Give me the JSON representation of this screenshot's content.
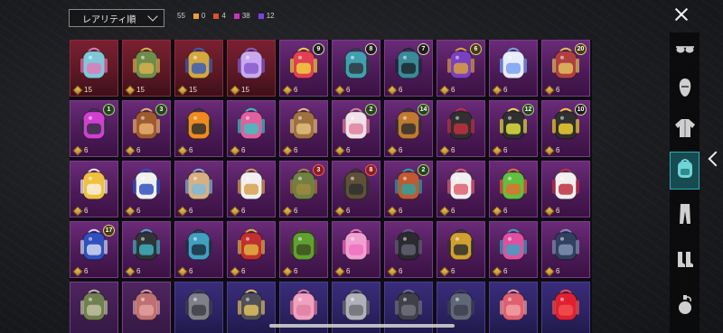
{
  "header": {
    "sort_label": "レアリティ順",
    "total_count": "55",
    "rarity_counts": [
      {
        "color": "#f0a030",
        "count": "0"
      },
      {
        "color": "#e05030",
        "count": "4"
      },
      {
        "color": "#d030c0",
        "count": "38"
      },
      {
        "color": "#8040e0",
        "count": "12"
      }
    ]
  },
  "items": [
    {
      "icon": "backpack-teal-icon",
      "qty": "15",
      "rarity": "red",
      "c1": "#7fc8d8",
      "c2": "#e07ab8"
    },
    {
      "icon": "backpack-green-icon",
      "qty": "15",
      "rarity": "red",
      "c1": "#6f8d4a",
      "c2": "#d8b050"
    },
    {
      "icon": "backpack-gold-blue-icon",
      "qty": "15",
      "rarity": "red",
      "c1": "#d4a840",
      "c2": "#3a5fb8"
    },
    {
      "icon": "backpack-butterfly-icon",
      "qty": "15",
      "rarity": "red",
      "c1": "#c9a8f0",
      "c2": "#8a5ad0"
    },
    {
      "icon": "backpack-clown-icon",
      "qty": "6",
      "badge": "9",
      "badge_style": "",
      "c1": "#e04050",
      "c2": "#f0d040"
    },
    {
      "icon": "backpack-robot-icon",
      "qty": "6",
      "badge": "8",
      "badge_style": "",
      "c1": "#40a0b0",
      "c2": "#303840"
    },
    {
      "icon": "backpack-mech-icon",
      "qty": "6",
      "badge": "7",
      "badge_style": "",
      "c1": "#3a8a98",
      "c2": "#1c2830"
    },
    {
      "icon": "backpack-arch-icon",
      "qty": "6",
      "badge": "6",
      "badge_style": "gold",
      "c1": "#7a40c0",
      "c2": "#d8a040"
    },
    {
      "icon": "backpack-bunny-icon",
      "qty": "6",
      "c1": "#e8ecff",
      "c2": "#7aa0f0"
    },
    {
      "icon": "backpack-bear-red-icon",
      "qty": "6",
      "badge": "20",
      "badge_style": "gold",
      "c1": "#b04040",
      "c2": "#e0c060"
    },
    {
      "icon": "backpack-crystal-icon",
      "qty": "6",
      "badge": "1",
      "badge_style": "green",
      "c1": "#d040d0",
      "c2": "#303040"
    },
    {
      "icon": "backpack-teddy-icon",
      "qty": "6",
      "badge": "3",
      "badge_style": "green",
      "c1": "#a05a30",
      "c2": "#e8b070"
    },
    {
      "icon": "backpack-orange-ball-icon",
      "qty": "6",
      "c1": "#f08a20",
      "c2": "#303030"
    },
    {
      "icon": "backpack-candy-icon",
      "qty": "6",
      "c1": "#e060a0",
      "c2": "#40c0c0"
    },
    {
      "icon": "backpack-chest-icon",
      "qty": "6",
      "c1": "#a07040",
      "c2": "#e0c080"
    },
    {
      "icon": "backpack-shell-icon",
      "qty": "6",
      "badge": "2",
      "badge_style": "green",
      "c1": "#f0e0e8",
      "c2": "#e080a0"
    },
    {
      "icon": "backpack-bronze-icon",
      "qty": "6",
      "badge": "14",
      "badge_style": "green",
      "c1": "#c07a30",
      "c2": "#303030"
    },
    {
      "icon": "backpack-dark-red-icon",
      "qty": "6",
      "c1": "#303030",
      "c2": "#c03040"
    },
    {
      "icon": "backpack-tablet-icon",
      "qty": "6",
      "badge": "12",
      "badge_style": "green",
      "c1": "#303030",
      "c2": "#e0e040"
    },
    {
      "icon": "backpack-phone-icon",
      "qty": "6",
      "badge": "10",
      "badge_style": "",
      "c1": "#303030",
      "c2": "#f0d030"
    },
    {
      "icon": "backpack-tiger-icon",
      "qty": "6",
      "c1": "#f0c040",
      "c2": "#f8f0e0"
    },
    {
      "icon": "backpack-striped-icon",
      "qty": "6",
      "c1": "#f0f0f0",
      "c2": "#3050c0"
    },
    {
      "icon": "backpack-doll-icon",
      "qty": "6",
      "c1": "#d8b080",
      "c2": "#80b8d8"
    },
    {
      "icon": "backpack-chef-icon",
      "qty": "6",
      "c1": "#f0f0f0",
      "c2": "#d8a050"
    },
    {
      "icon": "backpack-camo-icon",
      "qty": "6",
      "badge": "3",
      "badge_style": "red",
      "c1": "#708040",
      "c2": "#a08840"
    },
    {
      "icon": "backpack-tactical-icon",
      "qty": "6",
      "badge": "8",
      "badge_style": "red",
      "c1": "#605038",
      "c2": "#303030"
    },
    {
      "icon": "backpack-tribal-icon",
      "qty": "6",
      "badge": "2",
      "badge_style": "green",
      "c1": "#c05a30",
      "c2": "#30a0a0"
    },
    {
      "icon": "backpack-cat-icon",
      "qty": "6",
      "c1": "#f0f0f0",
      "c2": "#e06070"
    },
    {
      "icon": "backpack-monster-icon",
      "qty": "6",
      "c1": "#60c040",
      "c2": "#e07030"
    },
    {
      "icon": "backpack-white-red-icon",
      "qty": "6",
      "c1": "#f0f0f0",
      "c2": "#c03040"
    },
    {
      "icon": "backpack-blue-beast-icon",
      "qty": "6",
      "badge": "17",
      "badge_style": "gold",
      "c1": "#3050c0",
      "c2": "#d0d8f0"
    },
    {
      "icon": "backpack-dark-teal-icon",
      "qty": "6",
      "c1": "#303438",
      "c2": "#40b0c0"
    },
    {
      "icon": "backpack-cyber-icon",
      "qty": "6",
      "c1": "#40a0c0",
      "c2": "#203040"
    },
    {
      "icon": "backpack-mask-icon",
      "qty": "6",
      "c1": "#c03030",
      "c2": "#e0b040"
    },
    {
      "icon": "backpack-olive-icon",
      "qty": "6",
      "c1": "#60a030",
      "c2": "#405020"
    },
    {
      "icon": "backpack-pink-ribbon-icon",
      "qty": "6",
      "c1": "#f0a0d0",
      "c2": "#f070c0"
    },
    {
      "icon": "backpack-black-icon",
      "qty": "6",
      "c1": "#2a2a30",
      "c2": "#606070"
    },
    {
      "icon": "backpack-gold-black-icon",
      "qty": "6",
      "c1": "#d0a030",
      "c2": "#303030"
    },
    {
      "icon": "backpack-frame-icon",
      "qty": "6",
      "c1": "#e050a0",
      "c2": "#40a0c0"
    },
    {
      "icon": "backpack-navy-icon",
      "qty": "6",
      "c1": "#304060",
      "c2": "#8090b0"
    },
    {
      "icon": "backpack-army-icon",
      "qty": "",
      "rarity": "purple-dark",
      "c1": "#708050",
      "c2": "#c0c0a0"
    },
    {
      "icon": "backpack-rose-icon",
      "qty": "",
      "rarity": "purple-dark",
      "c1": "#c07070",
      "c2": "#e0a0a0"
    },
    {
      "icon": "backpack-grey-icon",
      "qty": "",
      "rarity": "blue",
      "c1": "#80808a",
      "c2": "#404048"
    },
    {
      "icon": "backpack-charcoal-icon",
      "qty": "",
      "rarity": "blue",
      "c1": "#505058",
      "c2": "#e0c060"
    },
    {
      "icon": "backpack-pink-icon",
      "qty": "",
      "rarity": "blue",
      "c1": "#f0a0c0",
      "c2": "#e080a0"
    },
    {
      "icon": "backpack-grey-light-icon",
      "qty": "",
      "rarity": "blue",
      "c1": "#b0b0b8",
      "c2": "#707078"
    },
    {
      "icon": "backpack-dark-grey-icon",
      "qty": "",
      "rarity": "blue",
      "c1": "#404048",
      "c2": "#707080"
    },
    {
      "icon": "backpack-slate-icon",
      "qty": "",
      "rarity": "blue",
      "c1": "#606878",
      "c2": "#404050"
    },
    {
      "icon": "backpack-coral-icon",
      "qty": "",
      "rarity": "blue",
      "c1": "#e06070",
      "c2": "#f0a0a0"
    },
    {
      "icon": "backpack-red-icon",
      "qty": "",
      "rarity": "blue",
      "c1": "#e02030",
      "c2": "#f05050"
    }
  ],
  "sidebar_tabs": [
    {
      "icon": "glasses-icon",
      "active": false
    },
    {
      "icon": "face-icon",
      "active": false
    },
    {
      "icon": "jacket-icon",
      "active": false
    },
    {
      "icon": "backpack-icon",
      "active": true
    },
    {
      "icon": "pants-icon",
      "active": false
    },
    {
      "icon": "boots-icon",
      "active": false
    },
    {
      "icon": "grenade-icon",
      "active": false
    }
  ]
}
